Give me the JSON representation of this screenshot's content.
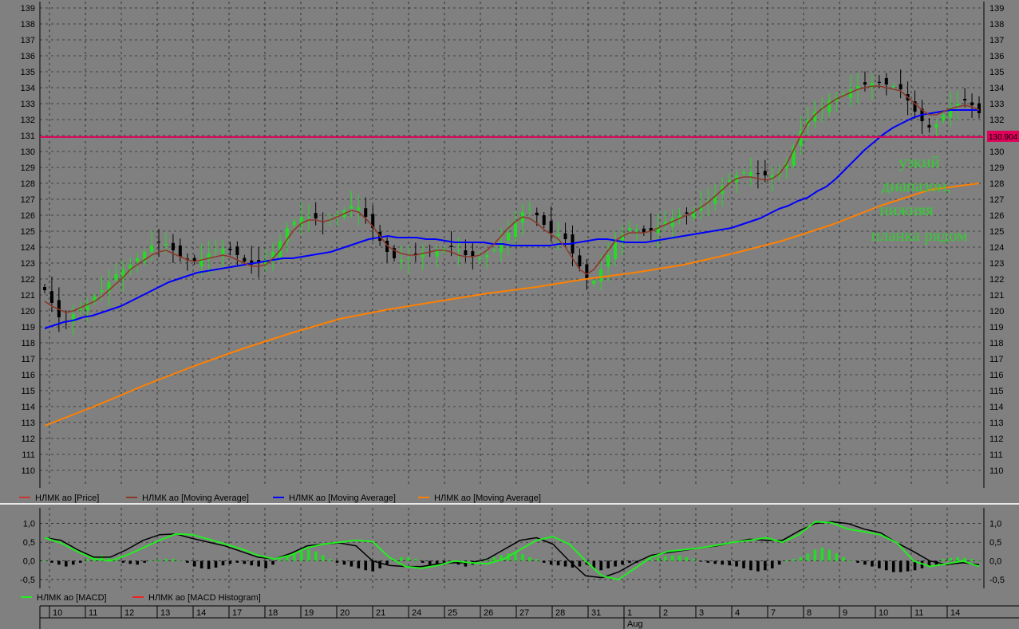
{
  "colors": {
    "background": "#808080",
    "grid": "#000000",
    "up_candle": "#22dd22",
    "down_candle": "#000000",
    "ma_short": "#8b3a2a",
    "ma_mid": "#0000ff",
    "ma_long": "#ff8000",
    "level_line": "#e0005a",
    "macd_line": "#22ee22",
    "signal_line": "#000000",
    "annotation": "#33cc33"
  },
  "annotation": [
    "узкий",
    "диапазон,",
    "нижняя",
    "планка рядом"
  ],
  "price_label": "130.904",
  "chart_data": [
    {
      "type": "candlestick",
      "ylim": [
        109.5,
        139
      ],
      "y_ticks": [
        110,
        111,
        112,
        113,
        114,
        115,
        116,
        117,
        118,
        119,
        120,
        121,
        122,
        123,
        124,
        125,
        126,
        127,
        128,
        129,
        130,
        131,
        132,
        133,
        134,
        135,
        136,
        137,
        138,
        139
      ],
      "horizontal_level": 130.904,
      "legend": [
        {
          "name": "НЛМК ао [Price]",
          "color": "#cc3333"
        },
        {
          "name": "НЛМК ао [Moving Average]",
          "color": "#8b3a2a"
        },
        {
          "name": "НЛМК ао [Moving Average]",
          "color": "#0000ff"
        },
        {
          "name": "НЛМК ао [Moving Average]",
          "color": "#ff8000"
        }
      ],
      "close_series": [
        121.3,
        120.5,
        119.6,
        119.3,
        119.8,
        120.2,
        120.5,
        120.9,
        121.3,
        121.8,
        122.3,
        122.6,
        122.9,
        123.3,
        123.7,
        124.1,
        124.3,
        124.2,
        123.8,
        123.4,
        123.2,
        123.1,
        123.3,
        123.6,
        123.8,
        123.9,
        123.8,
        123.5,
        123.1,
        122.9,
        123.0,
        123.2,
        123.7,
        124.4,
        125.2,
        125.6,
        125.9,
        125.9,
        125.8,
        125.6,
        125.7,
        126.0,
        126.3,
        126.6,
        126.5,
        125.9,
        125.2,
        124.4,
        123.7,
        123.3,
        123.2,
        123.3,
        123.5,
        123.6,
        123.7,
        123.8,
        123.9,
        124.0,
        123.8,
        123.5,
        123.4,
        123.3,
        123.5,
        123.8,
        124.3,
        124.9,
        125.6,
        126.2,
        126.4,
        126.0,
        125.4,
        124.9,
        124.8,
        124.5,
        123.6,
        122.8,
        122.0,
        121.9,
        122.6,
        123.5,
        124.3,
        124.8,
        125.2,
        125.1,
        124.9,
        125.0,
        125.3,
        125.6,
        125.8,
        126.0,
        126.1,
        126.3,
        126.6,
        126.9,
        127.3,
        127.8,
        128.2,
        128.5,
        128.7,
        128.7,
        128.6,
        128.5,
        128.5,
        128.7,
        129.3,
        130.3,
        131.3,
        132.0,
        132.5,
        132.8,
        133.2,
        133.4,
        133.6,
        133.9,
        134.1,
        134.2,
        134.3,
        134.3,
        134.2,
        134.1,
        133.9,
        133.2,
        132.5,
        131.9,
        131.5,
        131.7,
        132.3,
        132.8,
        133.0,
        133.2,
        132.9,
        132.4
      ],
      "ma_short": [
        120.6,
        120.3,
        120.1,
        119.9,
        120.0,
        120.2,
        120.4,
        120.6,
        120.9,
        121.3,
        121.7,
        122.1,
        122.6,
        122.9,
        123.2,
        123.5,
        123.7,
        123.8,
        123.6,
        123.4,
        123.2,
        123.1,
        123.2,
        123.3,
        123.4,
        123.5,
        123.4,
        123.2,
        123.0,
        122.8,
        122.8,
        122.9,
        123.3,
        123.8,
        124.5,
        125.1,
        125.5,
        125.7,
        125.7,
        125.6,
        125.7,
        125.9,
        126.1,
        126.3,
        126.2,
        125.8,
        125.3,
        124.7,
        124.1,
        123.8,
        123.6,
        123.5,
        123.5,
        123.6,
        123.7,
        123.8,
        123.8,
        123.7,
        123.5,
        123.4,
        123.4,
        123.5,
        123.8,
        124.2,
        124.7,
        125.2,
        125.6,
        125.9,
        125.8,
        125.5,
        125.1,
        124.8,
        124.5,
        124.0,
        123.3,
        122.6,
        122.3,
        122.6,
        123.2,
        123.8,
        124.4,
        124.7,
        124.9,
        124.9,
        124.9,
        125.0,
        125.2,
        125.4,
        125.6,
        125.8,
        126.0,
        126.2,
        126.5,
        126.8,
        127.2,
        127.6,
        128.0,
        128.3,
        128.4,
        128.4,
        128.3,
        128.2,
        128.3,
        128.6,
        129.2,
        130.1,
        131.0,
        131.8,
        132.3,
        132.7,
        133.0,
        133.3,
        133.5,
        133.7,
        133.9,
        134.0,
        134.1,
        134.1,
        134.0,
        133.9,
        133.8,
        133.4,
        133.0,
        132.6,
        132.3,
        132.3,
        132.5,
        132.7,
        132.8,
        132.9,
        132.8,
        132.6
      ],
      "ma_mid": [
        118.9,
        119.1,
        119.3,
        119.4,
        119.6,
        119.7,
        119.9,
        120.1,
        120.3,
        120.6,
        120.9,
        121.2,
        121.5,
        121.8,
        122.0,
        122.2,
        122.4,
        122.5,
        122.6,
        122.7,
        122.8,
        122.9,
        123.0,
        123.1,
        123.2,
        123.3,
        123.3,
        123.4,
        123.5,
        123.6,
        123.7,
        123.9,
        124.1,
        124.3,
        124.5,
        124.6,
        124.7,
        124.6,
        124.6,
        124.6,
        124.5,
        124.5,
        124.4,
        124.3,
        124.3,
        124.3,
        124.3,
        124.2,
        124.2,
        124.1,
        124.1,
        124.1,
        124.1,
        124.1,
        124.2,
        124.2,
        124.3,
        124.4,
        124.5,
        124.5,
        124.4,
        124.3,
        124.3,
        124.3,
        124.4,
        124.5,
        124.6,
        124.7,
        124.8,
        124.9,
        125.0,
        125.1,
        125.2,
        125.4,
        125.6,
        125.8,
        126.1,
        126.4,
        126.6,
        126.9,
        127.1,
        127.5,
        127.8,
        128.3,
        128.9,
        129.5,
        130.1,
        130.6,
        131.1,
        131.5,
        131.8,
        132.1,
        132.3,
        132.4,
        132.5,
        132.6,
        132.6,
        132.6,
        132.6
      ],
      "ma_long": [
        112.8,
        114.0,
        115.3,
        116.5,
        117.6,
        118.6,
        119.5,
        120.1,
        120.6,
        121.1,
        121.5,
        122.0,
        122.4,
        122.9,
        123.6,
        124.4,
        125.4,
        126.6,
        127.6,
        128.0
      ],
      "x_ticks": [
        "10",
        "11",
        "12",
        "13",
        "14",
        "17",
        "18",
        "19",
        "20",
        "21",
        "24",
        "25",
        "26",
        "27",
        "28",
        "31",
        "1",
        "2",
        "3",
        "4",
        "7",
        "8",
        "9",
        "10",
        "11",
        "14"
      ],
      "x_month_label": "Aug"
    },
    {
      "type": "line",
      "ylim": [
        -0.65,
        1.25
      ],
      "y_ticks": [
        -0.5,
        0.0,
        0.5,
        1.0
      ],
      "y_tick_labels": [
        "-0,5",
        "0,0",
        "0,5",
        "1,0"
      ],
      "legend": [
        {
          "name": "НЛМК ао [MACD]",
          "color": "#22ee22"
        },
        {
          "name": "НЛМК ао [MACD Histogram]",
          "color": "#ee2222"
        }
      ],
      "macd": [
        0.62,
        0.48,
        0.25,
        0.05,
        0.0,
        0.15,
        0.35,
        0.55,
        0.72,
        0.7,
        0.58,
        0.45,
        0.32,
        0.15,
        0.05,
        0.15,
        0.35,
        0.45,
        0.5,
        0.55,
        0.52,
        0.1,
        -0.15,
        -0.2,
        -0.12,
        0.0,
        -0.05,
        -0.08,
        0.05,
        0.3,
        0.55,
        0.65,
        0.45,
        0.0,
        -0.4,
        -0.5,
        -0.2,
        0.1,
        0.25,
        0.3,
        0.35,
        0.42,
        0.5,
        0.55,
        0.62,
        0.5,
        0.7,
        1.05,
        1.02,
        0.85,
        0.78,
        0.7,
        0.48,
        0.0,
        -0.15,
        -0.08,
        0.0,
        -0.15
      ],
      "signal": [
        0.62,
        0.55,
        0.3,
        0.1,
        0.1,
        0.3,
        0.55,
        0.7,
        0.72,
        0.6,
        0.5,
        0.4,
        0.25,
        0.1,
        0.05,
        0.2,
        0.4,
        0.45,
        0.48,
        0.4,
        0.0,
        -0.12,
        -0.15,
        -0.15,
        -0.08,
        -0.05,
        -0.05,
        0.05,
        0.3,
        0.55,
        0.62,
        0.45,
        0.0,
        -0.4,
        -0.45,
        -0.3,
        -0.05,
        0.15,
        0.22,
        0.28,
        0.35,
        0.4,
        0.5,
        0.58,
        0.55,
        0.55,
        0.8,
        1.0,
        1.05,
        1.0,
        0.85,
        0.75,
        0.48,
        0.25,
        0.0,
        -0.1,
        -0.05,
        -0.1
      ],
      "histogram": [
        0.0,
        -0.05,
        -0.1,
        -0.15,
        -0.1,
        -0.05,
        0.05,
        0.12,
        0.15,
        0.08,
        0.0,
        -0.05,
        -0.08,
        -0.1,
        -0.05,
        0.0,
        0.03,
        0.05,
        0.05,
        0.02,
        -0.05,
        -0.15,
        -0.2,
        -0.22,
        -0.18,
        -0.12,
        -0.08,
        -0.05,
        -0.08,
        -0.12,
        -0.15,
        -0.2,
        -0.1,
        0.05,
        0.15,
        0.2,
        0.25,
        0.3,
        0.25,
        0.15,
        0.05,
        -0.05,
        -0.1,
        -0.15,
        -0.2,
        -0.25,
        -0.28,
        -0.2,
        -0.1,
        0.05,
        0.1,
        0.1,
        0.05,
        -0.05,
        -0.1,
        -0.08,
        -0.05,
        -0.05,
        -0.1,
        -0.15,
        -0.1,
        0.0,
        0.05,
        0.1,
        0.15,
        0.2,
        0.25,
        0.18,
        0.1,
        0.05,
        -0.05,
        -0.1,
        -0.12,
        -0.15,
        -0.18,
        -0.15,
        -0.1,
        -0.2,
        -0.25,
        -0.2,
        -0.15,
        -0.1,
        -0.05,
        -0.05,
        0.0,
        0.05,
        0.1,
        0.12,
        0.15,
        0.15,
        0.1,
        0.05,
        -0.02,
        -0.05,
        -0.08,
        -0.1,
        -0.12,
        -0.15,
        -0.2,
        -0.25,
        -0.28,
        -0.25,
        -0.2,
        -0.1,
        0.0,
        0.05,
        0.1,
        0.2,
        0.3,
        0.35,
        0.3,
        0.2,
        0.1,
        0.0,
        -0.05,
        -0.1,
        -0.15,
        -0.2,
        -0.25,
        -0.3,
        -0.3,
        -0.28,
        -0.25,
        -0.2,
        -0.15,
        -0.1,
        0.05,
        0.08,
        0.1,
        0.08,
        0.05,
        0.02
      ]
    }
  ]
}
